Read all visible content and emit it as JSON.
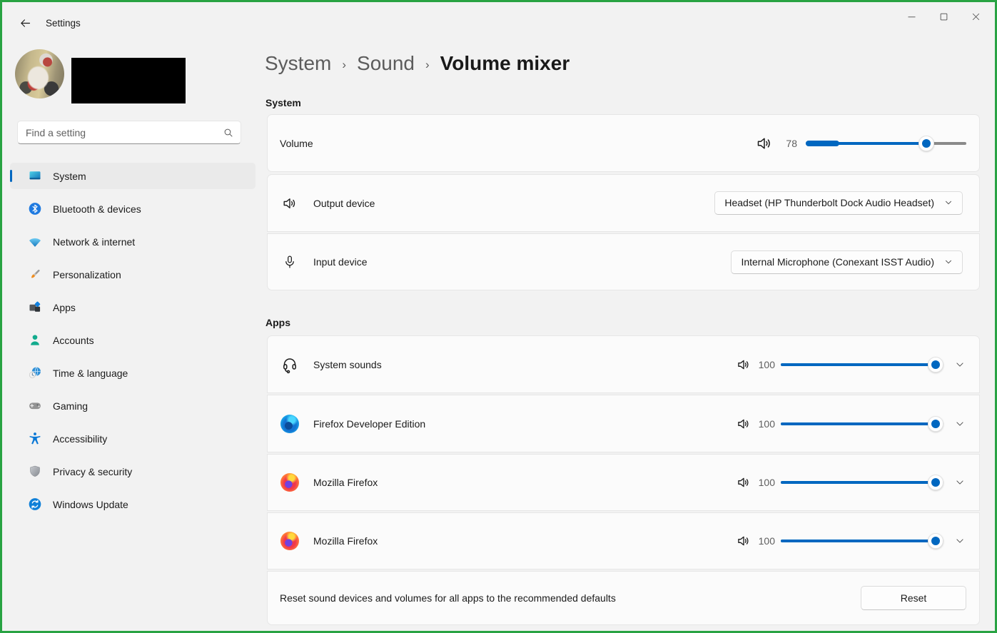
{
  "window": {
    "title": "Settings"
  },
  "colors": {
    "accent": "#0067c0",
    "record_border": "#28a343",
    "page_bg": "#f2f2f2",
    "card_bg": "#fbfbfb",
    "slider_track": "#8a8a8a"
  },
  "titlebar": {
    "controls": [
      "minimize",
      "maximize",
      "close"
    ]
  },
  "sidebar": {
    "search": {
      "placeholder": "Find a setting"
    },
    "items": [
      {
        "label": "System",
        "icon": "system-icon",
        "selected": true
      },
      {
        "label": "Bluetooth & devices",
        "icon": "bluetooth-icon",
        "selected": false
      },
      {
        "label": "Network & internet",
        "icon": "network-icon",
        "selected": false
      },
      {
        "label": "Personalization",
        "icon": "personalization-icon",
        "selected": false
      },
      {
        "label": "Apps",
        "icon": "apps-icon",
        "selected": false
      },
      {
        "label": "Accounts",
        "icon": "accounts-icon",
        "selected": false
      },
      {
        "label": "Time & language",
        "icon": "time-language-icon",
        "selected": false
      },
      {
        "label": "Gaming",
        "icon": "gaming-icon",
        "selected": false
      },
      {
        "label": "Accessibility",
        "icon": "accessibility-icon",
        "selected": false
      },
      {
        "label": "Privacy & security",
        "icon": "privacy-security-icon",
        "selected": false
      },
      {
        "label": "Windows Update",
        "icon": "windows-update-icon",
        "selected": false
      }
    ]
  },
  "breadcrumb": {
    "crumbs": [
      "System",
      "Sound"
    ],
    "separator": "›",
    "current": "Volume mixer"
  },
  "system": {
    "title": "System",
    "volume": {
      "label": "Volume",
      "value": 78,
      "max": 100,
      "icon": "speaker-icon"
    },
    "output": {
      "label": "Output device",
      "icon": "speaker-icon",
      "value": "Headset (HP Thunderbolt Dock Audio Headset)"
    },
    "input": {
      "label": "Input device",
      "icon": "microphone-icon",
      "value": "Internal Microphone (Conexant ISST Audio)"
    }
  },
  "apps": {
    "title": "Apps",
    "rows": [
      {
        "name": "System sounds",
        "icon": "headset-icon",
        "volume": 100
      },
      {
        "name": "Firefox Developer Edition",
        "icon": "firefox-developer-icon",
        "volume": 100
      },
      {
        "name": "Mozilla Firefox",
        "icon": "firefox-icon",
        "volume": 100
      },
      {
        "name": "Mozilla Firefox",
        "icon": "firefox-icon",
        "volume": 100
      }
    ],
    "reset": {
      "description": "Reset sound devices and volumes for all apps to the recommended defaults",
      "button_label": "Reset"
    }
  }
}
